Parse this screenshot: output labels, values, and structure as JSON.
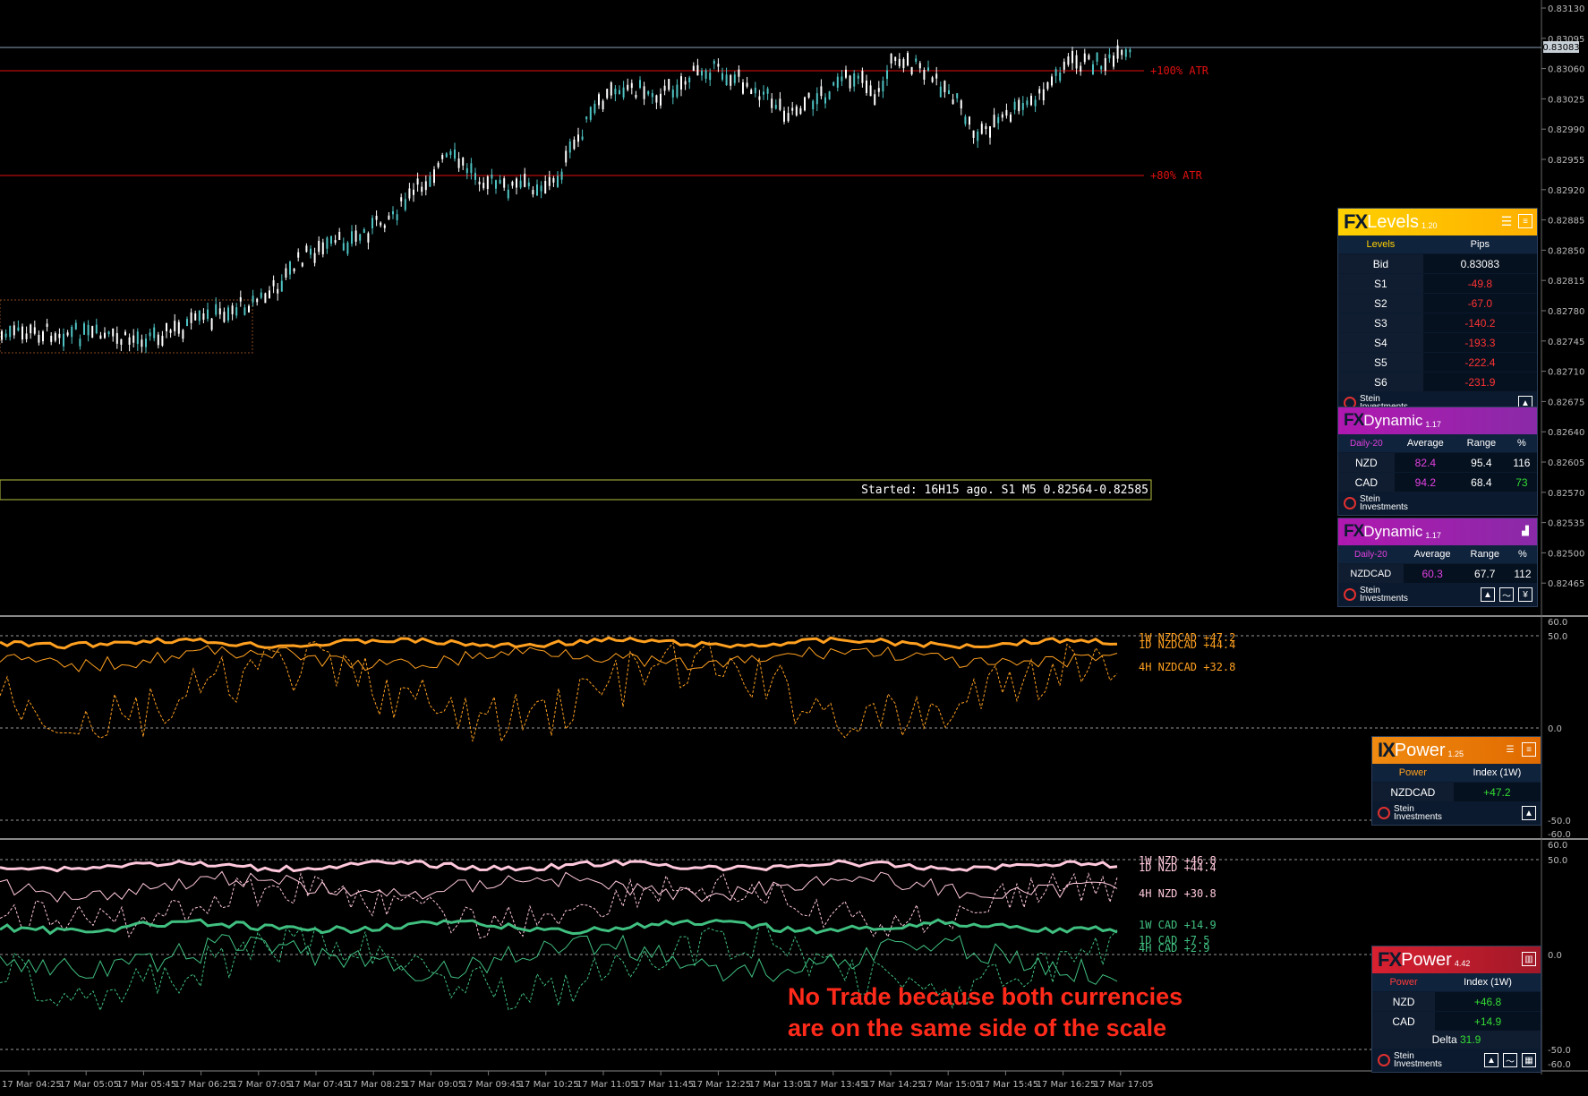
{
  "price_axis": {
    "labels": [
      "0.83130",
      "0.83095",
      "0.83060",
      "0.83025",
      "0.82990",
      "0.82955",
      "0.82920",
      "0.82885",
      "0.82850",
      "0.82815",
      "0.82780",
      "0.82745",
      "0.82710",
      "0.82675",
      "0.82640",
      "0.82605",
      "0.82570",
      "0.82535",
      "0.82500",
      "0.82465"
    ],
    "current_price": "0.83083"
  },
  "atr_lines": {
    "plus100": "+100% ATR",
    "plus80": "+80% ATR"
  },
  "started_text": "Started: 16H15 ago. S1 M5 0.82564-0.82585",
  "ixpower_pane": {
    "axis": [
      "60.0",
      "50.0",
      "0.0",
      "-50.0",
      "-60.0"
    ],
    "labels": [
      "1W NZDCAD +47.2",
      "1D NZDCAD +44.4",
      "4H NZDCAD +32.8"
    ]
  },
  "fxpower_pane": {
    "axis": [
      "60.0",
      "50.0",
      "0.0",
      "-50.0",
      "-60.0"
    ],
    "labels": [
      "1W NZD +46.8",
      "1D NZD +44.4",
      "4H NZD +30.8",
      "1W CAD +14.9",
      "1D CAD  +7.5",
      "4H CAD  +2.9"
    ]
  },
  "annotation": {
    "line1": "No Trade because both currencies",
    "line2": "are on the same side of the scale"
  },
  "time_axis": [
    "17 Mar 04:25",
    "17 Mar 05:05",
    "17 Mar 05:45",
    "17 Mar 06:25",
    "17 Mar 07:05",
    "17 Mar 07:45",
    "17 Mar 08:25",
    "17 Mar 09:05",
    "17 Mar 09:45",
    "17 Mar 10:25",
    "17 Mar 11:05",
    "17 Mar 11:45",
    "17 Mar 12:25",
    "17 Mar 13:05",
    "17 Mar 13:45",
    "17 Mar 14:25",
    "17 Mar 15:05",
    "17 Mar 15:45",
    "17 Mar 16:25",
    "17 Mar 17:05"
  ],
  "fxlevels": {
    "brand_a": "FX",
    "brand_b": "Levels",
    "version": "1.20",
    "col1": "Levels",
    "col2": "Pips",
    "rows": [
      {
        "label": "Bid",
        "value": "0.83083"
      },
      {
        "label": "S1",
        "value": "-49.8"
      },
      {
        "label": "S2",
        "value": "-67.0"
      },
      {
        "label": "S3",
        "value": "-140.2"
      },
      {
        "label": "S4",
        "value": "-193.3"
      },
      {
        "label": "S5",
        "value": "-222.4"
      },
      {
        "label": "S6",
        "value": "-231.9"
      }
    ],
    "footer_a": "Stein",
    "footer_b": "Investments"
  },
  "fxdynamic1": {
    "brand_a": "FX",
    "brand_b": "Dynamic",
    "version": "1.17",
    "headers": [
      "Daily-20",
      "Average",
      "Range",
      "%"
    ],
    "rows": [
      {
        "label": "NZD",
        "avg": "82.4",
        "range": "95.4",
        "pct": "116"
      },
      {
        "label": "CAD",
        "avg": "94.2",
        "range": "68.4",
        "pct": "73"
      }
    ],
    "footer_a": "Stein",
    "footer_b": "Investments"
  },
  "fxdynamic2": {
    "brand_a": "FX",
    "brand_b": "Dynamic",
    "version": "1.17",
    "headers": [
      "Daily-20",
      "Average",
      "Range",
      "%"
    ],
    "rows": [
      {
        "label": "NZDCAD",
        "avg": "60.3",
        "range": "67.7",
        "pct": "112"
      }
    ],
    "footer_a": "Stein",
    "footer_b": "Investments"
  },
  "ixpower_widget": {
    "brand_a": "IX",
    "brand_b": "Power",
    "version": "1.25",
    "col1": "Power",
    "col2": "Index (1W)",
    "rows": [
      {
        "label": "NZDCAD",
        "value": "+47.2"
      }
    ],
    "footer_a": "Stein",
    "footer_b": "Investments"
  },
  "fxpower_widget": {
    "brand_a": "FX",
    "brand_b": "Power",
    "version": "4.42",
    "col1": "Power",
    "col2": "Index (1W)",
    "rows": [
      {
        "label": "NZD",
        "value": "+46.8"
      },
      {
        "label": "CAD",
        "value": "+14.9"
      }
    ],
    "delta_label": "Delta",
    "delta_value": "31.9",
    "footer_a": "Stein",
    "footer_b": "Investments"
  },
  "colors": {
    "bull": "#4fc3c3",
    "bear": "#ffffff",
    "atr": "#e01010",
    "ixpower": "#ffa020",
    "nzd": "#ffc8dc",
    "cad": "#40c080",
    "annotation": "#ff2a1a"
  }
}
